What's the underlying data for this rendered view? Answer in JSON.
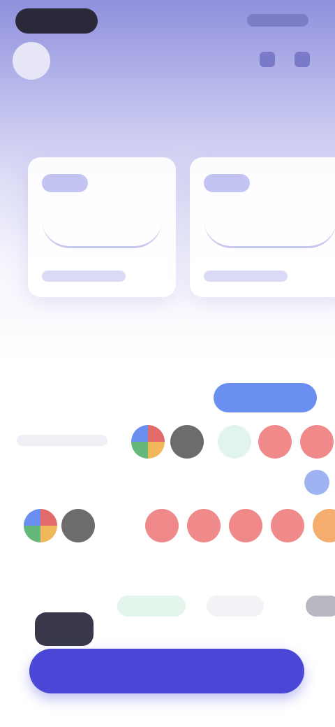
{
  "header": {
    "brand": "",
    "icons": [
      "search-icon",
      "menu-icon"
    ]
  },
  "cards": [
    {
      "tag": "",
      "value": "",
      "sub": ""
    },
    {
      "tag": "",
      "value": "",
      "sub": ""
    }
  ],
  "section_colors": {
    "title": "",
    "action_label": "",
    "row_label": "",
    "swatches": [
      "multicolor",
      "#6c6c6c",
      "#e2f4ec",
      "#f08a8a",
      "#f08a8a"
    ]
  },
  "section_palette": {
    "title": "",
    "swatches": [
      "multicolor",
      "#6c6c6c",
      "#f08a8a",
      "#f08a8a",
      "#f08a8a",
      "#f08a8a",
      "#f4ad6e"
    ]
  },
  "section_tags": {
    "title": "",
    "tabs": [
      "",
      "",
      ""
    ],
    "item_text": ""
  },
  "cta": {
    "label": ""
  },
  "colors": {
    "accent": "#4b47d6",
    "hero": "#8f8fdc"
  }
}
